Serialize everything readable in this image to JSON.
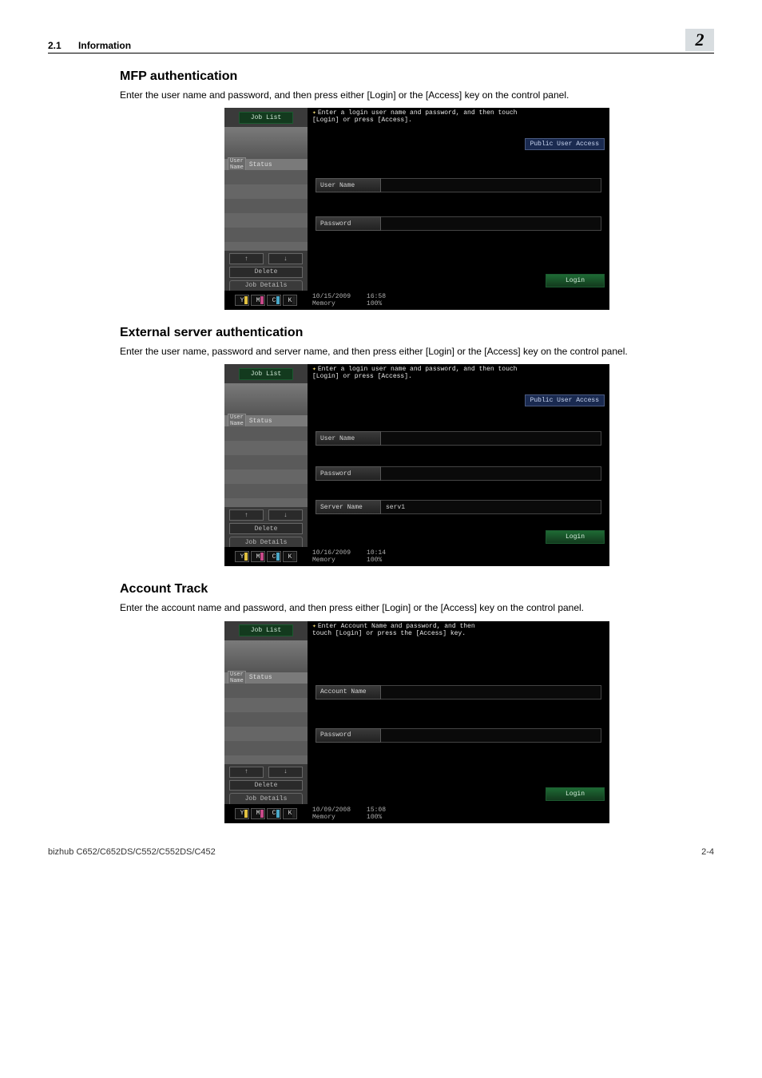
{
  "header": {
    "section_number": "2.1",
    "section_title": "Information",
    "chapter_number": "2"
  },
  "sections": {
    "s1": {
      "title": "MFP authentication",
      "body": "Enter the user name and password, and then press either [Login] or the [Access] key on the control panel."
    },
    "s2": {
      "title": "External server authentication",
      "body": "Enter the user name, password and server name, and then press either [Login] or the [Access] key on the control panel."
    },
    "s3": {
      "title": "Account Track",
      "body": "Enter the account name and password, and then press either [Login] or the [Access] key on the control panel."
    }
  },
  "panel_common": {
    "job_list": "Job List",
    "hint_line1": "Enter a login user name and password, and then touch",
    "hint_line2": "[Login] or press [Access].",
    "hint3_line1": "Enter Account Name and password, and then",
    "hint3_line2": "touch [Login] or press the [Access] key.",
    "public_user_access": "Public User Access",
    "left_header_user": "User\nName",
    "left_header_status": "Status",
    "arrow_up": "↑",
    "arrow_down": "↓",
    "delete": "Delete",
    "job_details": "Job Details",
    "login": "Login",
    "memory_label": "Memory",
    "memory_value": "100%",
    "toner": {
      "y": "Y",
      "m": "M",
      "c": "C",
      "k": "K"
    }
  },
  "panels": {
    "p1": {
      "fields": {
        "user_name": "User Name",
        "password": "Password"
      },
      "date": "10/15/2009",
      "time": "16:58"
    },
    "p2": {
      "fields": {
        "user_name": "User Name",
        "password": "Password",
        "server_name": "Server Name",
        "server_value": "serv1"
      },
      "date": "10/16/2009",
      "time": "10:14"
    },
    "p3": {
      "fields": {
        "account_name": "Account Name",
        "password": "Password"
      },
      "date": "10/09/2008",
      "time": "15:08"
    }
  },
  "footer": {
    "model": "bizhub C652/C652DS/C552/C552DS/C452",
    "page": "2-4"
  }
}
